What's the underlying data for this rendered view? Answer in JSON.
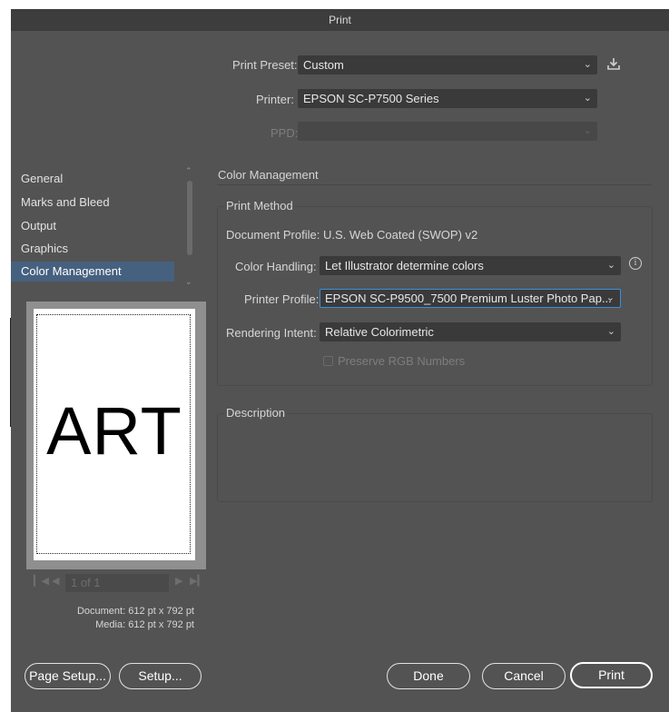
{
  "window": {
    "title": "Print"
  },
  "top": {
    "preset_label": "Print Preset:",
    "preset_value": "Custom",
    "printer_label": "Printer:",
    "printer_value": "EPSON SC-P7500 Series",
    "ppd_label": "PPD:"
  },
  "sidebar": {
    "items": [
      {
        "label": "General"
      },
      {
        "label": "Marks and Bleed"
      },
      {
        "label": "Output"
      },
      {
        "label": "Graphics"
      },
      {
        "label": "Color Management"
      }
    ]
  },
  "preview": {
    "art_text": "ART",
    "page_field": "1 of 1",
    "document_info": "Document: 612 pt x 792 pt",
    "media_info": "Media: 612 pt x 792 pt"
  },
  "color_management": {
    "section_title": "Color Management",
    "print_method_title": "Print Method",
    "document_profile_label": "Document Profile:",
    "document_profile_value": "U.S. Web Coated (SWOP) v2",
    "color_handling_label": "Color Handling:",
    "color_handling_value": "Let Illustrator determine colors",
    "printer_profile_label": "Printer Profile:",
    "printer_profile_value": "EPSON SC-P9500_7500 Premium Luster Photo Pap...",
    "rendering_intent_label": "Rendering Intent:",
    "rendering_intent_value": "Relative Colorimetric",
    "preserve_rgb_label": "Preserve RGB Numbers",
    "preserve_rgb_checked": false
  },
  "description": {
    "title": "Description"
  },
  "buttons": {
    "page_setup": "Page Setup...",
    "setup": "Setup...",
    "done": "Done",
    "cancel": "Cancel",
    "print": "Print"
  },
  "colors": {
    "dialog_bg": "#535353",
    "field_bg": "#3a3a3a",
    "selection": "#46607f",
    "focus_ring": "#3d8fd8"
  }
}
